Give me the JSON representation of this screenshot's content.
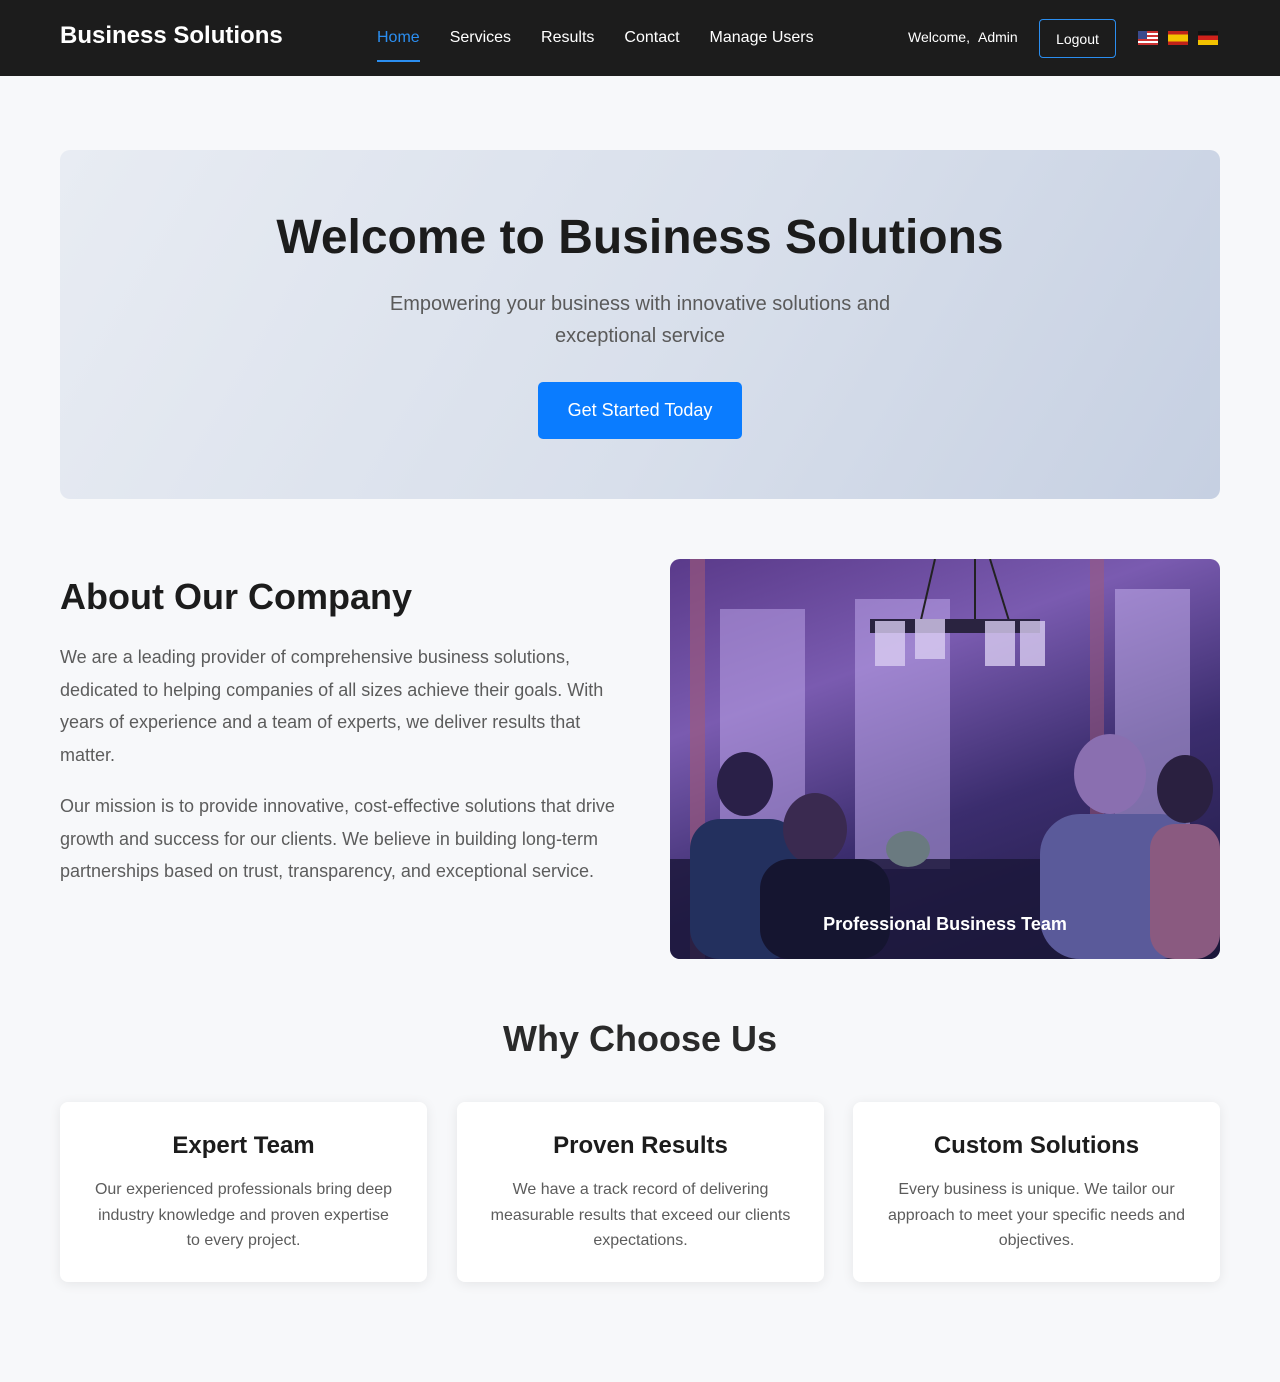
{
  "nav": {
    "brand": "Business Solutions",
    "links": [
      {
        "label": "Home",
        "active": true
      },
      {
        "label": "Services",
        "active": false
      },
      {
        "label": "Results",
        "active": false
      },
      {
        "label": "Contact",
        "active": false
      },
      {
        "label": "Manage Users",
        "active": false
      }
    ],
    "welcome_label": "Welcome,",
    "username": "Admin",
    "logout_label": "Logout",
    "flags": [
      "us-flag-icon",
      "es-flag-icon",
      "de-flag-icon"
    ],
    "accent_color": "#2b8ef0"
  },
  "hero": {
    "title": "Welcome to Business Solutions",
    "subtitle": "Empowering your business with innovative solutions and exceptional service",
    "cta_label": "Get Started Today",
    "cta_color": "#0a7cff"
  },
  "about": {
    "title": "About Our Company",
    "paragraph1": "We are a leading provider of comprehensive business solutions, dedicated to helping companies of all sizes achieve their goals. With years of experience and a team of experts, we deliver results that matter.",
    "paragraph2": "Our mission is to provide innovative, cost-effective solutions that drive growth and success for our clients. We believe in building long-term partnerships based on trust, transparency, and exceptional service.",
    "image_caption": "Professional Business Team"
  },
  "why": {
    "title": "Why Choose Us",
    "cards": [
      {
        "title": "Expert Team",
        "text": "Our experienced professionals bring deep industry knowledge and proven expertise to every project."
      },
      {
        "title": "Proven Results",
        "text": "We have a track record of delivering measurable results that exceed our clients expectations."
      },
      {
        "title": "Custom Solutions",
        "text": "Every business is unique. We tailor our approach to meet your specific needs and objectives."
      }
    ]
  }
}
